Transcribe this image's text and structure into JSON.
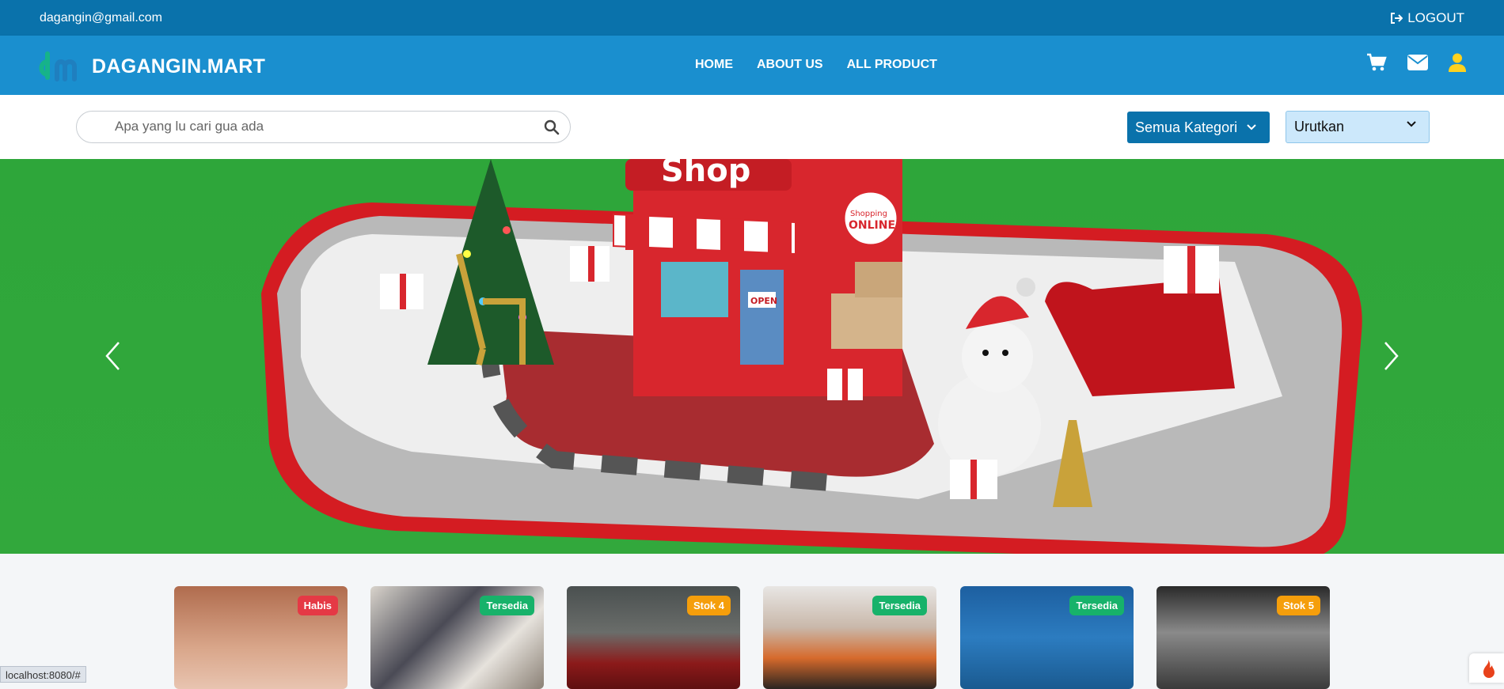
{
  "topbar": {
    "email": "dagangin@gmail.com",
    "logout": "LOGOUT"
  },
  "brand": {
    "name": "DAGANGIN.MART"
  },
  "menu": [
    "HOME",
    "ABOUT US",
    "ALL PRODUCT"
  ],
  "nav_icons": [
    "cart-icon",
    "envelope-icon",
    "user-icon"
  ],
  "search": {
    "placeholder": "Apa yang lu cari gua ada"
  },
  "filters": {
    "category": "Semua Kategori",
    "sort": "Urutkan"
  },
  "hero": {
    "slide_text": [
      "Shop",
      "Shopping ONLINE",
      "OPEN"
    ]
  },
  "products": [
    {
      "badge": "Habis",
      "badge_color": "#e53945"
    },
    {
      "badge": "Tersedia",
      "badge_color": "#17b26a"
    },
    {
      "badge": "Stok 4",
      "badge_color": "#f59e0b"
    },
    {
      "badge": "Tersedia",
      "badge_color": "#17b26a"
    },
    {
      "badge": "Tersedia",
      "badge_color": "#17b26a"
    },
    {
      "badge": "Stok 5",
      "badge_color": "#f59e0b"
    }
  ],
  "status_url": "localhost:8080/#",
  "colors": {
    "topbar": "#0a72ab",
    "navbar": "#1a8fcf",
    "hero_bg": "#32a83c"
  }
}
